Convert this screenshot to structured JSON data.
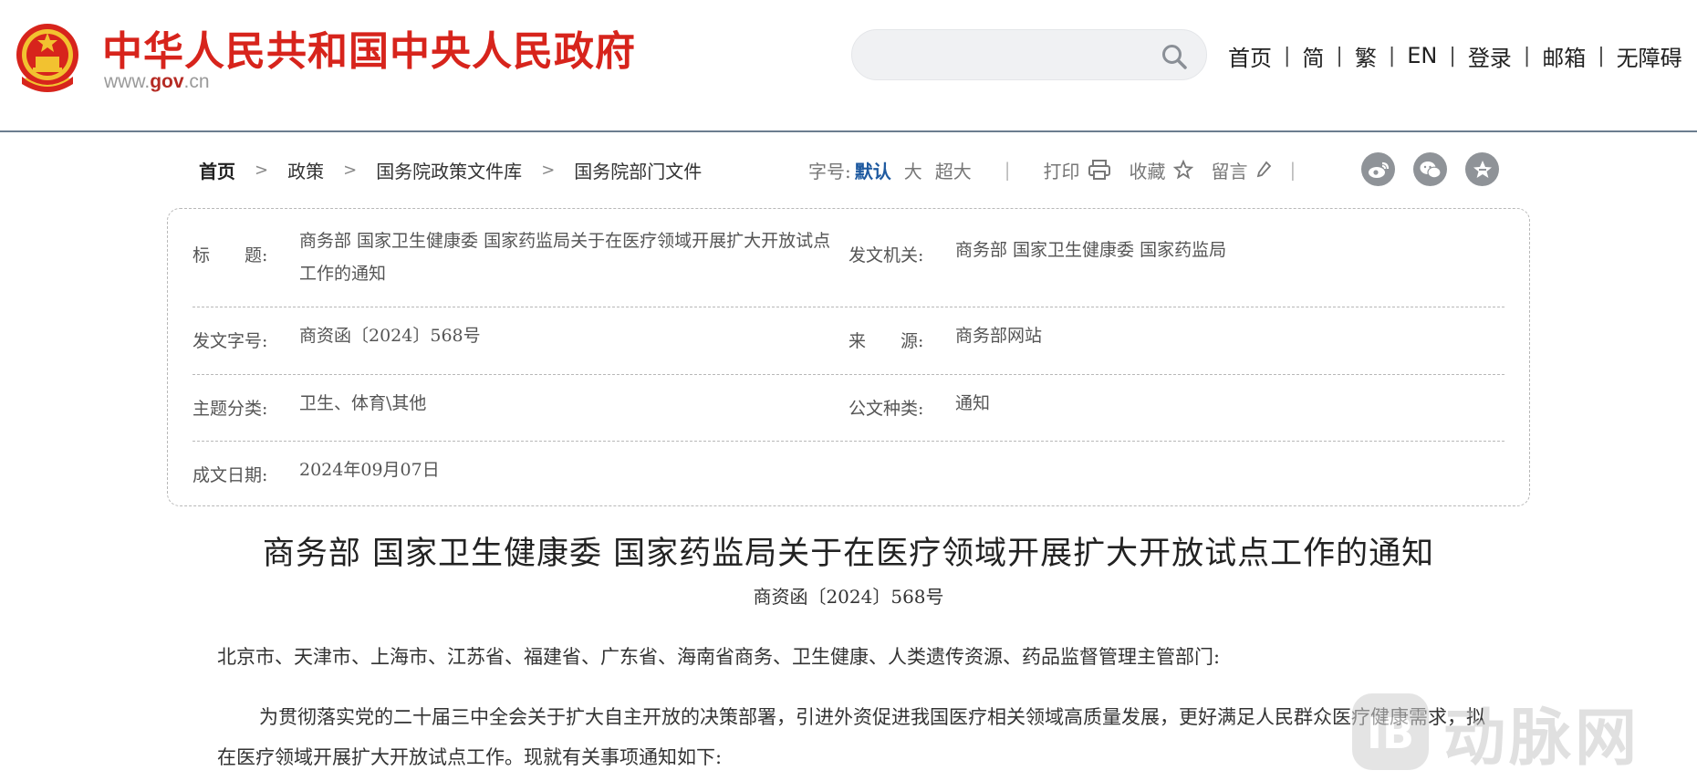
{
  "header": {
    "site_name": "中华人民共和国中央人民政府",
    "site_url_prefix": "www.",
    "site_url_domain": "gov",
    "site_url_suffix": ".cn",
    "search_placeholder": "",
    "nav": [
      "首页",
      "简",
      "繁",
      "EN",
      "登录",
      "邮箱",
      "无障碍"
    ]
  },
  "breadcrumb": {
    "items": [
      "首页",
      "政策",
      "国务院政策文件库",
      "国务院部门文件"
    ],
    "separator": ">"
  },
  "tools": {
    "font_size_label": "字号:",
    "font_default": "默认",
    "font_large": "大",
    "font_xlarge": "超大",
    "print_label": "打印",
    "favorite_label": "收藏",
    "comment_label": "留言",
    "share_icons": [
      "weibo-icon",
      "wechat-icon",
      "qzone-star-icon"
    ]
  },
  "info": {
    "title_label": "标　　题:",
    "title_value": "商务部 国家卫生健康委 国家药监局关于在医疗领域开展扩大开放试点工作的通知",
    "issuer_label": "发文机关:",
    "issuer_value": "商务部 国家卫生健康委 国家药监局",
    "doc_no_label": "发文字号:",
    "doc_no_value": "商资函〔2024〕568号",
    "source_label": "来　　源:",
    "source_value": "商务部网站",
    "topic_label": "主题分类:",
    "topic_value": "卫生、体育\\其他",
    "type_label": "公文种类:",
    "type_value": "通知",
    "date_label": "成文日期:",
    "date_value": "2024年09月07日"
  },
  "article": {
    "title": "商务部 国家卫生健康委 国家药监局关于在医疗领域开展扩大开放试点工作的通知",
    "doc_number": "商资函〔2024〕568号",
    "addressees": "北京市、天津市、上海市、江苏省、福建省、广东省、海南省商务、卫生健康、人类遗传资源、药品监督管理主管部门:",
    "paragraph_1": "为贯彻落实党的二十届三中全会关于扩大自主开放的决策部署，引进外资促进我国医疗相关领域高质量发展，更好满足人民群众医疗健康需求，拟在医疗领域开展扩大开放试点工作。现就有关事项通知如下:"
  },
  "watermark": {
    "text": "动脉网"
  },
  "colors": {
    "brand_red": "#d7241c",
    "link_blue": "#1f5aa0",
    "share_gray": "#8f9398"
  }
}
